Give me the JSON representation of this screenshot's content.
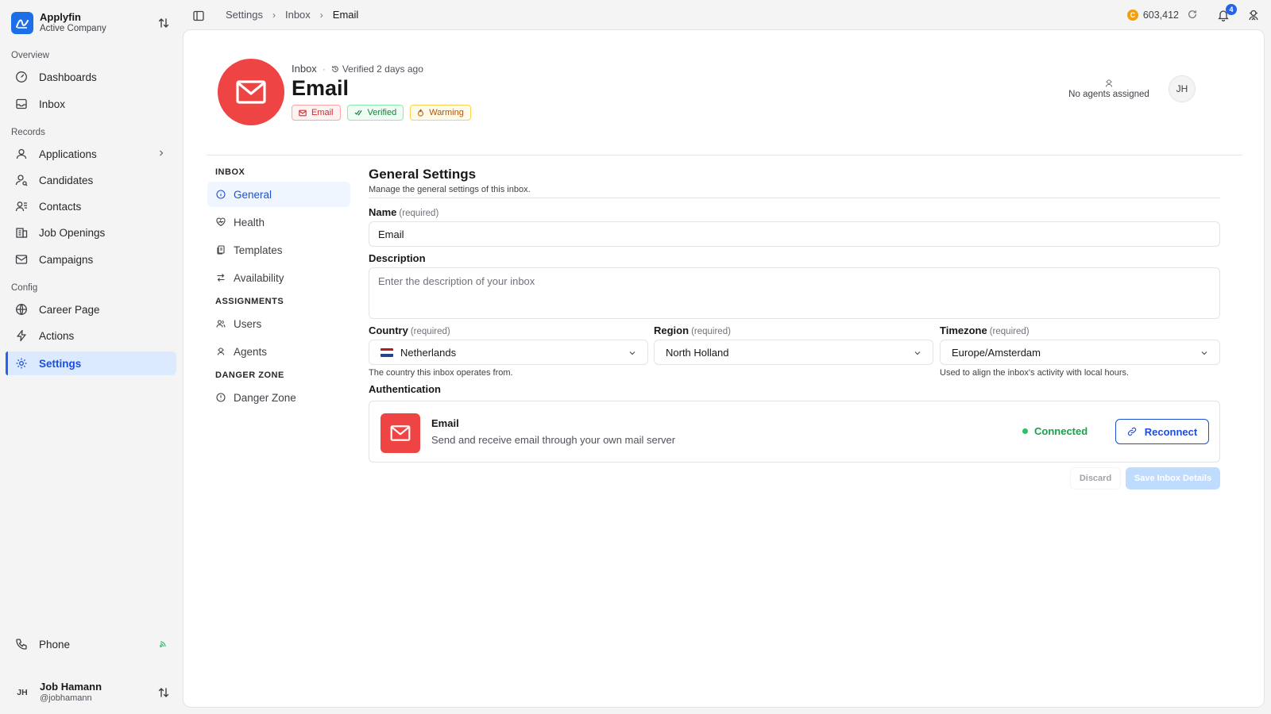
{
  "company": {
    "name": "Applyfin",
    "subtitle": "Active Company"
  },
  "sidebar": {
    "sections": [
      {
        "label": "Overview"
      },
      {
        "label": "Records"
      },
      {
        "label": "Config"
      }
    ],
    "items": [
      {
        "label": "Dashboards",
        "icon": "gauge-icon"
      },
      {
        "label": "Inbox",
        "icon": "inbox-icon"
      },
      {
        "label": "Applications",
        "icon": "user-icon"
      },
      {
        "label": "Candidates",
        "icon": "user-search-icon"
      },
      {
        "label": "Contacts",
        "icon": "contacts-icon"
      },
      {
        "label": "Job Openings",
        "icon": "building-icon"
      },
      {
        "label": "Campaigns",
        "icon": "mail-campaign-icon"
      },
      {
        "label": "Career Page",
        "icon": "globe-icon"
      },
      {
        "label": "Actions",
        "icon": "bolt-icon"
      },
      {
        "label": "Settings",
        "icon": "gear-icon"
      }
    ],
    "phone": {
      "label": "Phone"
    },
    "user": {
      "initials": "JH",
      "name": "Job Hamann",
      "handle": "@jobhamann"
    }
  },
  "topbar": {
    "breadcrumb": [
      "Settings",
      "Inbox",
      "Email"
    ],
    "credits": "603,412",
    "coin_letter": "C",
    "notification_count": "4"
  },
  "inbox_header": {
    "type": "Inbox",
    "verified": "Verified 2 days ago",
    "title": "Email",
    "tags": [
      "Email",
      "Verified",
      "Warming"
    ],
    "agents": "No agents assigned",
    "avatar": "JH"
  },
  "subnav": {
    "groups": [
      {
        "heading": "INBOX",
        "items": [
          "General",
          "Health",
          "Templates",
          "Availability"
        ]
      },
      {
        "heading": "ASSIGNMENTS",
        "items": [
          "Users",
          "Agents"
        ]
      },
      {
        "heading": "DANGER ZONE",
        "items": [
          "Danger Zone"
        ]
      }
    ],
    "active": "General"
  },
  "form": {
    "title": "General Settings",
    "subtitle": "Manage the general settings of this inbox.",
    "required_text": "(required)",
    "name": {
      "label": "Name",
      "value": "Email"
    },
    "description": {
      "label": "Description",
      "placeholder": "Enter the description of your inbox"
    },
    "country": {
      "label": "Country",
      "value": "Netherlands",
      "help": "The country this inbox operates from."
    },
    "region": {
      "label": "Region",
      "value": "North Holland"
    },
    "timezone": {
      "label": "Timezone",
      "value": "Europe/Amsterdam",
      "help": "Used to align the inbox's activity with local hours."
    },
    "auth": {
      "label": "Authentication",
      "provider": "Email",
      "description": "Send and receive email through your own mail server",
      "status": "Connected",
      "reconnect": "Reconnect"
    },
    "discard": "Discard",
    "save": "Save Inbox Details"
  },
  "colors": {
    "accent": "#2563eb",
    "email_red": "#ef4444",
    "connected_green": "#16a34a"
  }
}
